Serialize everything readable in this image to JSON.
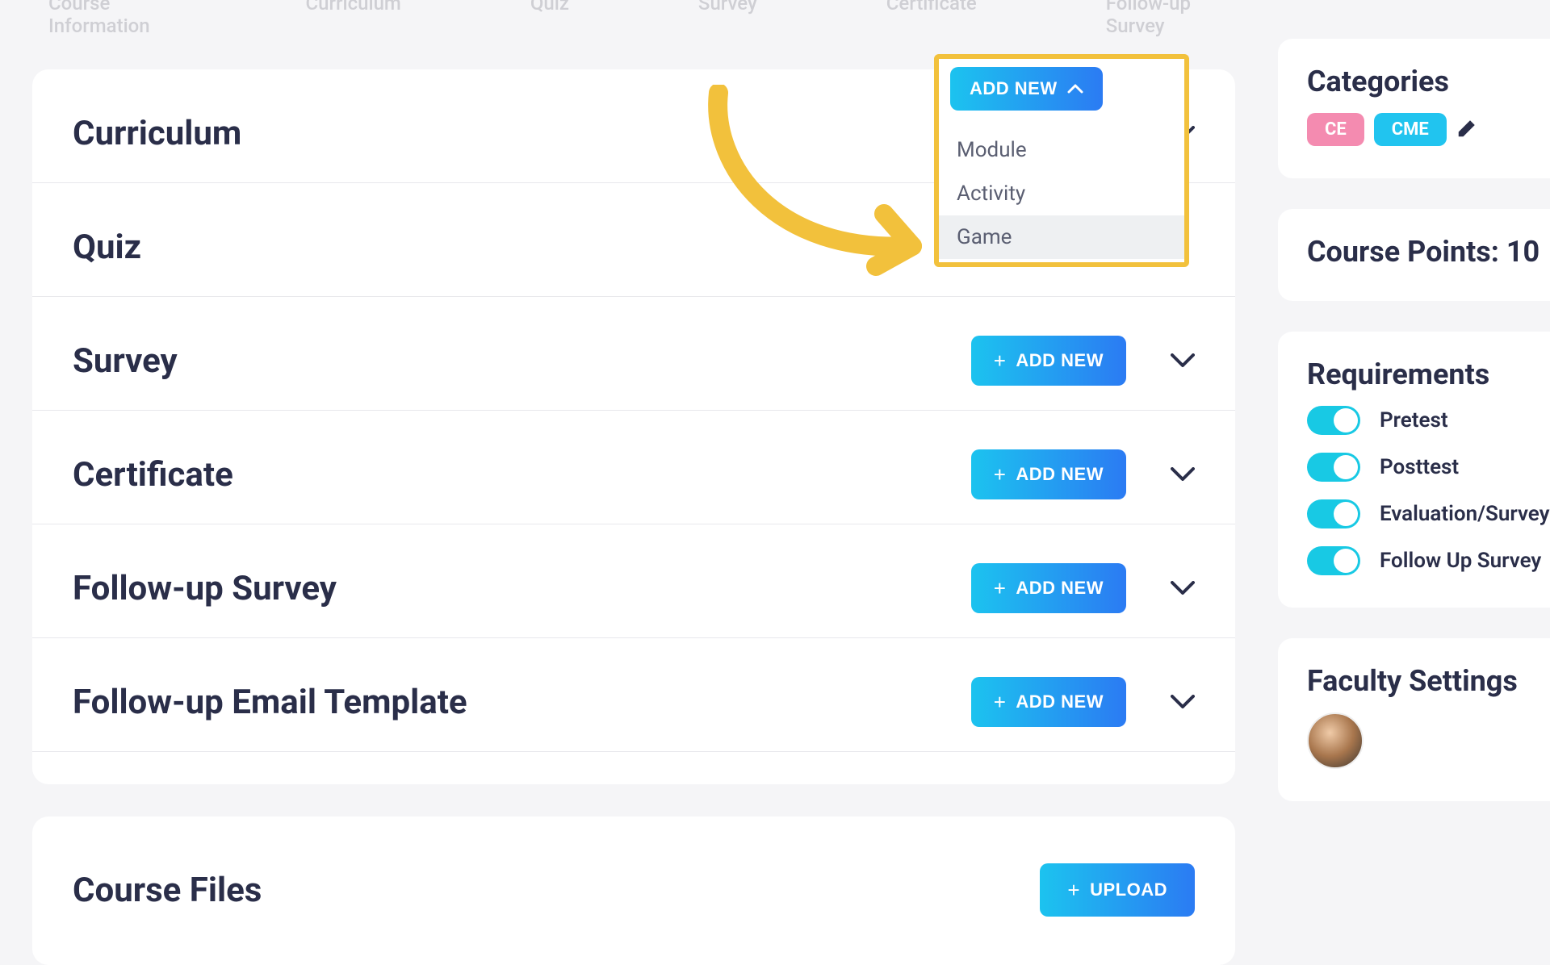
{
  "tabs": {
    "course_info": "Course Information",
    "curriculum": "Curriculum",
    "quiz": "Quiz",
    "survey": "Survey",
    "certificate": "Certificate",
    "followup": "Follow-up Survey"
  },
  "sections": {
    "curriculum": "Curriculum",
    "quiz": "Quiz",
    "survey": "Survey",
    "certificate": "Certificate",
    "followup_survey": "Follow-up Survey",
    "followup_email": "Follow-up Email Template",
    "course_files": "Course Files"
  },
  "buttons": {
    "add_new": "ADD NEW",
    "upload": "UPLOAD"
  },
  "dropdown": {
    "module": "Module",
    "activity": "Activity",
    "game": "Game"
  },
  "side": {
    "categories_title": "Categories",
    "badge_ce": "CE",
    "badge_cme": "CME",
    "points_title": "Course Points: 10",
    "requirements_title": "Requirements",
    "req_pretest": "Pretest",
    "req_posttest": "Posttest",
    "req_eval": "Evaluation/Survey",
    "req_follow": "Follow Up Survey",
    "faculty_title": "Faculty Settings"
  }
}
